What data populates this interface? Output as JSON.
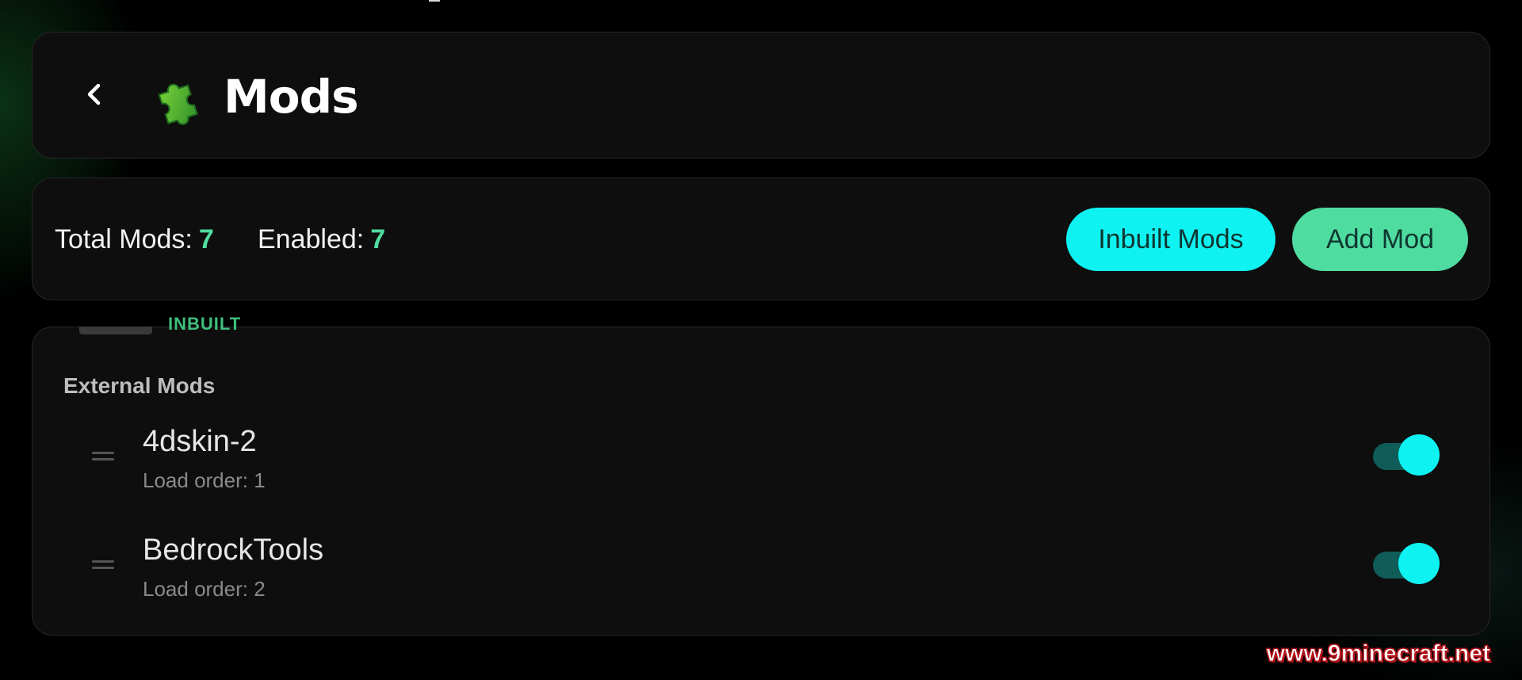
{
  "header": {
    "title": "Mods",
    "back_icon": "chevron-left-icon",
    "title_icon": "puzzle-piece-icon"
  },
  "stats": {
    "total_label": "Total Mods:",
    "total_value": "7",
    "enabled_label": "Enabled:",
    "enabled_value": "7"
  },
  "actions": {
    "inbuilt_label": "Inbuilt Mods",
    "add_label": "Add Mod"
  },
  "list": {
    "previous_item_tag": "INBUILT",
    "section_heading": "External Mods",
    "items": [
      {
        "name": "4dskin-2",
        "load_order": "Load order: 1",
        "enabled": true
      },
      {
        "name": "BedrockTools",
        "load_order": "Load order: 2",
        "enabled": true
      }
    ]
  },
  "watermark": "www.9minecraft.net",
  "colors": {
    "accent_cyan": "#0ff2f2",
    "accent_green": "#4fdca0",
    "card_background": "#0e0e0e",
    "page_background": "#000000"
  }
}
